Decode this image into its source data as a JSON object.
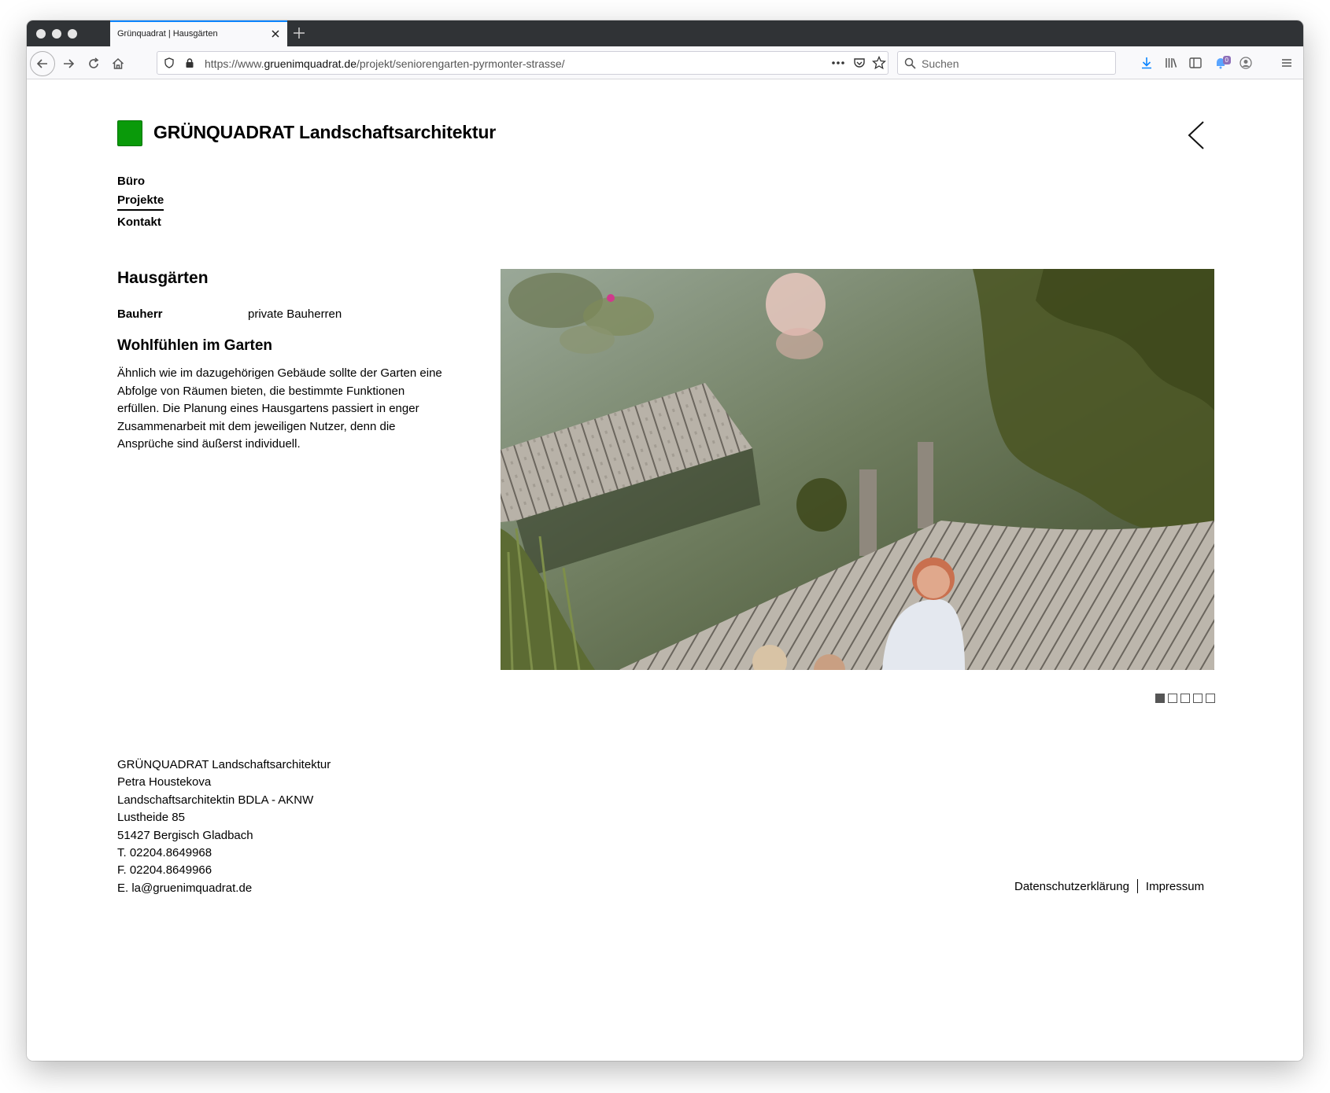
{
  "browser": {
    "tab_title": "Grünquadrat | Hausgärten",
    "url_base": "https://www.",
    "url_host": "gruenimquadrat.de",
    "url_path": "/projekt/seniorengarten-pyrmonter-strasse/",
    "search_placeholder": "Suchen",
    "notification_count": "0",
    "accent_color": "#0a84ff"
  },
  "site": {
    "title": "GRÜNQUADRAT Landschaftsarchitektur",
    "logo_color": "#0a9a0a"
  },
  "nav": {
    "items": [
      {
        "label": "Büro",
        "active": false
      },
      {
        "label": "Projekte",
        "active": true
      },
      {
        "label": "Kontakt",
        "active": false
      }
    ]
  },
  "project": {
    "title": "Hausgärten",
    "meta_label": "Bauherr",
    "meta_value": "private Bauherren",
    "heading": "Wohlfühlen im Garten",
    "description": "Ähnlich wie im dazugehörigen Gebäude sollte der Garten eine Abfolge von Räumen bieten, die bestimmte Funktionen erfüllen. Die Planung eines Hausgartens passiert in enger Zusammenarbeit mit dem jeweiligen Nutzer, denn die Ansprüche sind äußerst individuell."
  },
  "gallery": {
    "slide_count": 5,
    "active_index": 0
  },
  "footer": {
    "address_lines": [
      "GRÜNQUADRAT Landschaftsarchitektur",
      "Petra Houstekova",
      "Landschaftsarchitektin BDLA - AKNW",
      "Lustheide 85",
      "51427 Bergisch Gladbach",
      "T. 02204.8649968",
      "F. 02204.8649966",
      "E. la@gruenimquadrat.de"
    ],
    "privacy_link": "Datenschutzerklärung",
    "imprint_link": "Impressum"
  }
}
